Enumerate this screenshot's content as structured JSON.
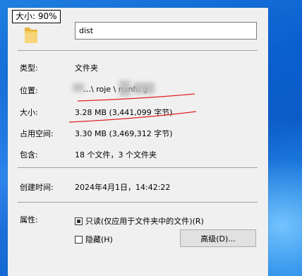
{
  "zoom_badge": "大小: 90%",
  "name_value": "dist",
  "properties": {
    "type_label": "类型:",
    "type_value": "文件夹",
    "location_label": "位置:",
    "location_value": "…\\ roje  \\  nanfo  g",
    "size_label": "大小:",
    "size_value": "3.28 MB (3,441,099 字节)",
    "disk_size_label": "占用空间:",
    "disk_size_value": "3.30 MB (3,469,312 字节)",
    "contains_label": "包含:",
    "contains_value": "18 个文件，3 个文件夹",
    "created_label": "创建时间:",
    "created_value": "2024年4月1日，14:42:22",
    "attributes_label": "属性:"
  },
  "attributes": {
    "readonly_label": "只读(仅应用于文件夹中的文件)(R)",
    "readonly_state": "indeterminate",
    "hidden_label": "隐藏(H)",
    "hidden_state": "unchecked",
    "advanced_button": "高级(D)..."
  },
  "colors": {
    "dialog_bg": "#f0f0f0",
    "annotation_red": "#e02020",
    "desktop_blue": "#0d6fd6",
    "folder_yellow": "#f2c94c"
  },
  "icons": {
    "folder": "folder-icon"
  }
}
